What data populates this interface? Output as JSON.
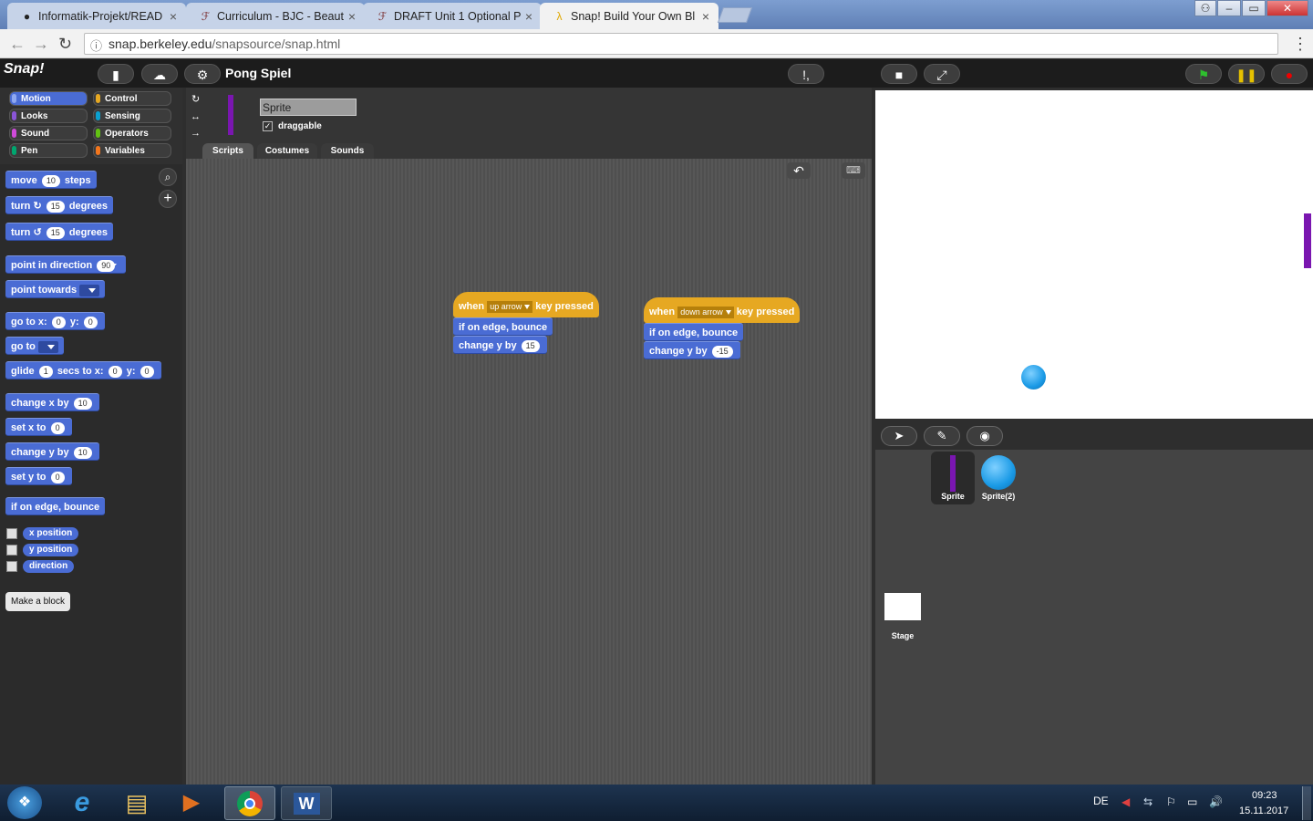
{
  "browser": {
    "tabs": [
      {
        "title": "Informatik-Projekt/READ",
        "icon": "github-icon"
      },
      {
        "title": "Curriculum - BJC - Beaut",
        "icon": "bjc-icon"
      },
      {
        "title": "DRAFT Unit 1 Optional P",
        "icon": "bjc-icon"
      },
      {
        "title": "Snap! Build Your Own Bl",
        "icon": "snap-lambda-icon"
      }
    ],
    "close_glyph": "×",
    "url_host": "snap.berkeley.edu",
    "url_path": "/snapsource/snap.html"
  },
  "snap": {
    "logo": "Snap!",
    "project_name": "Pong Spiel",
    "categories": [
      "Motion",
      "Control",
      "Looks",
      "Sensing",
      "Sound",
      "Operators",
      "Pen",
      "Variables"
    ],
    "category_colors": [
      "#4a6cd4",
      "#e6a822",
      "#8a55d7",
      "#0aa0d0",
      "#cf4ad9",
      "#62c213",
      "#00a66f",
      "#f3761d"
    ],
    "palette": {
      "move": {
        "a": "move",
        "v": "10",
        "b": "steps"
      },
      "turn_cw": {
        "a": "turn",
        "v": "15",
        "b": "degrees",
        "g": "↻"
      },
      "turn_ccw": {
        "a": "turn",
        "v": "15",
        "b": "degrees",
        "g": "↺"
      },
      "point_dir": {
        "a": "point in direction",
        "v": "90"
      },
      "point_towards": {
        "a": "point towards"
      },
      "goto_xy": {
        "a": "go to x:",
        "v1": "0",
        "m": "y:",
        "v2": "0"
      },
      "goto": {
        "a": "go to"
      },
      "glide": {
        "a": "glide",
        "v1": "1",
        "m1": "secs to x:",
        "v2": "0",
        "m2": "y:",
        "v3": "0"
      },
      "change_x": {
        "a": "change x by",
        "v": "10"
      },
      "set_x": {
        "a": "set x to",
        "v": "0"
      },
      "change_y": {
        "a": "change y by",
        "v": "10"
      },
      "set_y": {
        "a": "set y to",
        "v": "0"
      },
      "bounce": "if on edge, bounce",
      "reporters": [
        "x position",
        "y position",
        "direction"
      ],
      "make_block": "Make a block"
    },
    "sprite": {
      "name": "Sprite",
      "draggable": "draggable",
      "tabs": [
        "Scripts",
        "Costumes",
        "Sounds"
      ]
    },
    "scripts": [
      {
        "when": "when",
        "key": "up arrow",
        "pressed": "key pressed",
        "bounce": "if on edge, bounce",
        "change": "change y by",
        "value": "15"
      },
      {
        "when": "when",
        "key": "down arrow",
        "pressed": "key pressed",
        "bounce": "if on edge, bounce",
        "change": "change y by",
        "value": "-15"
      }
    ],
    "corral": {
      "sprites": [
        "Sprite",
        "Sprite(2)"
      ],
      "stage": "Stage"
    }
  },
  "taskbar": {
    "lang": "DE",
    "time": "09:23",
    "date": "15.11.2017"
  }
}
